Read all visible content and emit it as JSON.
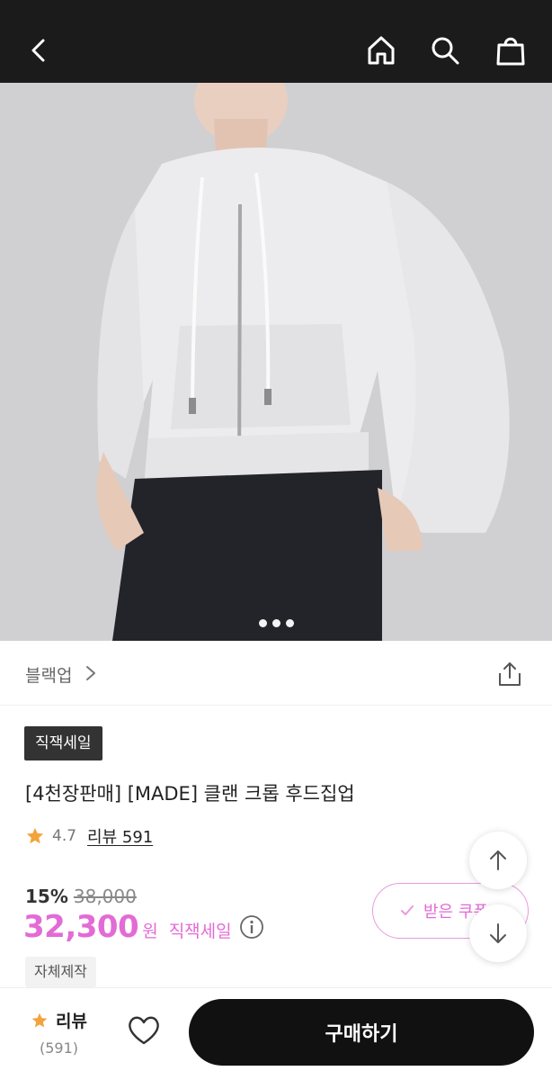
{
  "header": {
    "icons": [
      "back-icon",
      "home-icon",
      "search-icon",
      "bag-icon"
    ]
  },
  "gallery": {
    "image_desc_icon": "product-photo",
    "page_count": 3,
    "active_index": 0
  },
  "brand": {
    "name": "블랙업"
  },
  "product": {
    "badge": "직잭세일",
    "title": "[4천장판매] [MADE] 클랜 크롭 후드집업",
    "rating": "4.7",
    "review_link": "리뷰 591",
    "discount": "15%",
    "original_price": "38,000",
    "price": "32,300",
    "currency": "원",
    "sale_label": "직잭세일",
    "tag": "자체제작",
    "coupon_label": "받은 쿠폰"
  },
  "bottom_bar": {
    "review_label": "리뷰",
    "review_count": "(591)",
    "buy_label": "구매하기"
  },
  "colors": {
    "accent_pink": "#e36bd6",
    "header_bg": "#1b1b1b",
    "star": "#f2a33a",
    "buy_button": "#111111"
  }
}
